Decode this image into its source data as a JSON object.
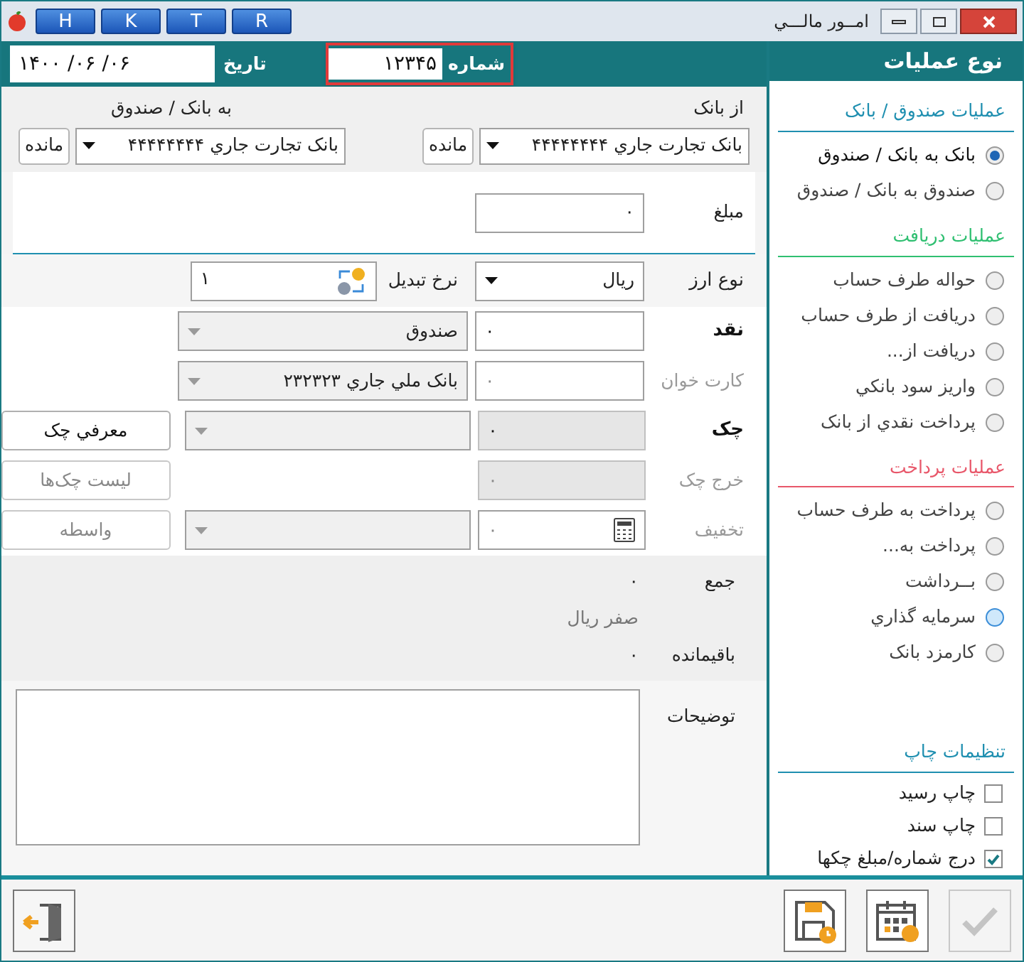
{
  "window": {
    "title": "امــور مالـــي",
    "quick_buttons": [
      "R",
      "T",
      "K",
      "H"
    ]
  },
  "header": {
    "date_label": "تاريخ",
    "date": "۱۴۰۰ /۰۶ /۰۶",
    "number_label": "شماره",
    "number": "۱۲۳۴۵"
  },
  "from_bank": {
    "label": "از بانک",
    "value": "بانک تجارت جاري ۴۴۴۴۴۴۴۴",
    "button": "مانده"
  },
  "to_bank": {
    "label": "به بانک / صندوق",
    "value": "بانک تجارت جاري ۴۴۴۴۴۴۴۴",
    "button": "مانده"
  },
  "amount": {
    "label": "مبلغ",
    "value": "۰"
  },
  "currency": {
    "label": "نوع ارز",
    "value": "ريال",
    "rate_label": "نرخ تبديل",
    "rate": "۱"
  },
  "payment_rows": [
    {
      "label": "نقد",
      "active": true,
      "amount": "۰",
      "amount_disabled": false,
      "account": {
        "value": "صندوق"
      }
    },
    {
      "label": "کارت خوان",
      "active": false,
      "amount": "۰",
      "amount_disabled": false,
      "account": {
        "value": "بانک ملي جاري ۲۳۲۳۲۳"
      }
    },
    {
      "label": "چک",
      "active": true,
      "amount": "۰",
      "amount_disabled": true,
      "account": {},
      "button": {
        "label": "معرفي چک",
        "disabled": false
      }
    },
    {
      "label": "خرج چک",
      "active": false,
      "amount": "۰",
      "amount_disabled": true,
      "button": {
        "label": "ليست چک‌ها",
        "disabled": true
      }
    },
    {
      "label": "تخفيف",
      "active": false,
      "amount": "۰",
      "amount_disabled": false,
      "calculator": true,
      "account": {},
      "button": {
        "label": "واسطه",
        "disabled": true
      }
    }
  ],
  "totals": {
    "sum_label": "جمع",
    "sum": "۰",
    "in_words": "صفر ريال",
    "remaining_label": "باقيمانده",
    "remaining": "۰"
  },
  "notes": {
    "label": "توضيحات"
  },
  "operations": {
    "title": "نوع عمليات",
    "groups": [
      {
        "title": "عمليات صندوق / بانک",
        "color": "#1f8fb0",
        "options": [
          {
            "label": "بانک به بانک / صندوق",
            "selected": true,
            "hovered": false
          },
          {
            "label": "صندوق به بانک / صندوق",
            "selected": false,
            "hovered": false
          }
        ]
      },
      {
        "title": "عمليات دريافت",
        "color": "#2fbf71",
        "options": [
          {
            "label": "حواله طرف حساب",
            "selected": false,
            "hovered": false
          },
          {
            "label": "دريافت از طرف حساب",
            "selected": false,
            "hovered": false
          },
          {
            "label": "دريافت از...",
            "selected": false,
            "hovered": false
          },
          {
            "label": "واريز سود بانکي",
            "selected": false,
            "hovered": false
          },
          {
            "label": "پرداخت نقدي از بانک",
            "selected": false,
            "hovered": false
          }
        ]
      },
      {
        "title": "عمليات پرداخت",
        "color": "#e8576a",
        "options": [
          {
            "label": "پرداخت به طرف حساب",
            "selected": false,
            "hovered": false
          },
          {
            "label": "پرداخت به...",
            "selected": false,
            "hovered": false
          },
          {
            "label": "بــرداشت",
            "selected": false,
            "hovered": false
          },
          {
            "label": "سرمايه گذاري",
            "selected": false,
            "hovered": true
          },
          {
            "label": "کارمزد بانک",
            "selected": false,
            "hovered": false
          }
        ]
      }
    ]
  },
  "print_settings": {
    "title": "تنظيمات چاپ",
    "options": [
      {
        "label": "چاپ رسيد",
        "checked": false
      },
      {
        "label": "چاپ سند",
        "checked": false
      },
      {
        "label": "درج شماره/مبلغ چکها",
        "checked": true
      }
    ]
  },
  "toolbar": {
    "confirm_disabled": true
  }
}
